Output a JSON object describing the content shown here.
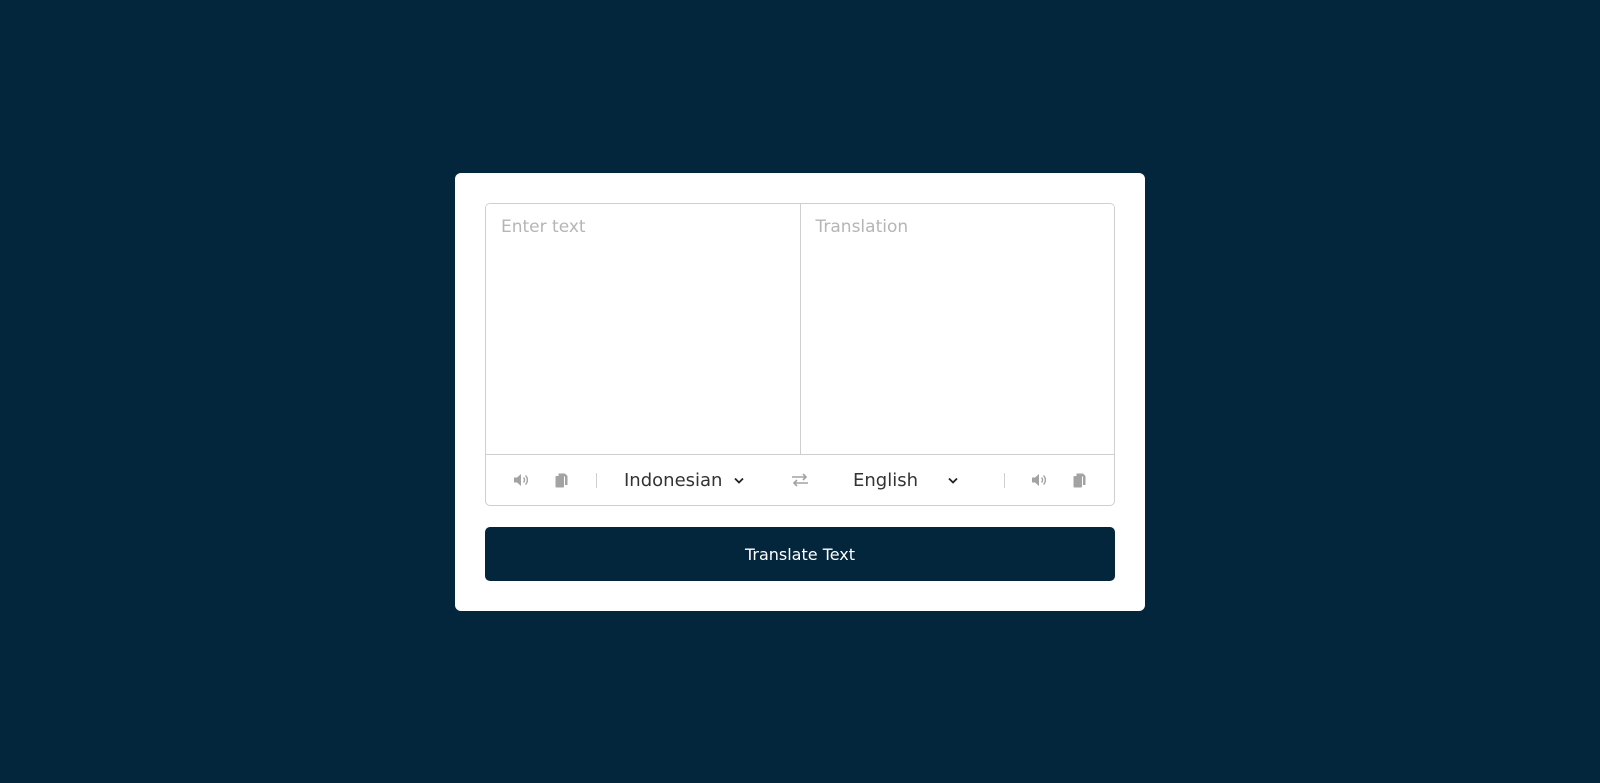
{
  "input": {
    "from_placeholder": "Enter text",
    "to_placeholder": "Translation"
  },
  "controls": {
    "from_language": "Indonesian",
    "to_language": "English"
  },
  "button": {
    "label": "Translate Text"
  },
  "icons": {
    "speaker": "volume-icon",
    "copy": "copy-icon",
    "swap": "exchange-icon",
    "chevron": "chevron-down-icon"
  },
  "colors": {
    "background": "#04263c",
    "card": "#ffffff",
    "border": "#cfcfcf",
    "icon": "#a3a3a3",
    "button": "#04263c"
  }
}
